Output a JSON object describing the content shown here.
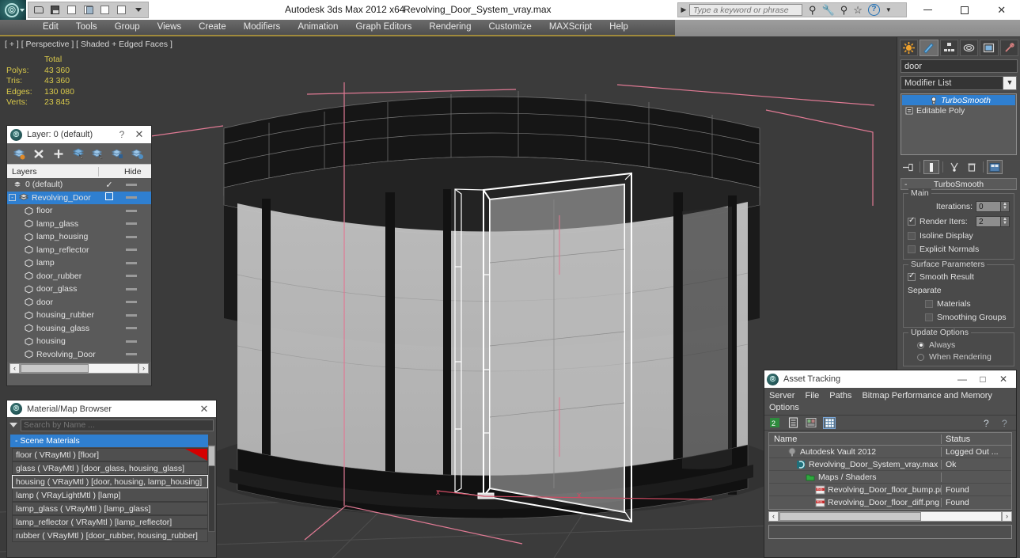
{
  "titlebar": {
    "app_title": "Autodesk 3ds Max  2012 x64",
    "file_name": "Revolving_Door_System_vray.max",
    "search_placeholder": "Type a keyword or phrase",
    "minimize": "—",
    "maximize": "□",
    "close": "✕",
    "help": "?",
    "quick_access": [
      "open-file-icon",
      "save-file-icon",
      "new-scene-icon",
      "set-xref-icon",
      "undo-icon",
      "redo-icon",
      "customize-qat-caret"
    ]
  },
  "menubar": {
    "items": [
      "Edit",
      "Tools",
      "Group",
      "Views",
      "Create",
      "Modifiers",
      "Animation",
      "Graph Editors",
      "Rendering",
      "Customize",
      "MAXScript",
      "Help"
    ]
  },
  "viewport": {
    "label": "[ + ] [ Perspective ] [ Shaded + Edged Faces ]",
    "stats": {
      "header": "Total",
      "rows": [
        {
          "label": "Polys:",
          "value": "43 360"
        },
        {
          "label": "Tris:",
          "value": "43 360"
        },
        {
          "label": "Edges:",
          "value": "130 080"
        },
        {
          "label": "Verts:",
          "value": "23 845"
        }
      ]
    },
    "gizmo_x_label": "x"
  },
  "layer_dialog": {
    "title": "Layer: 0 (default)",
    "help": "?",
    "close": "✕",
    "tools": [
      "create-new-layer-icon",
      "delete-highlighted-layers-icon",
      "add-selection-to-layer-icon",
      "select-objects-in-layer-icon",
      "select-highlighted-objects-icon",
      "highlight-selected-objects-layer-icon",
      "hide-unhide-layer-icon"
    ],
    "columns": {
      "layers": "Layers",
      "hide": "Hide"
    },
    "rows": [
      {
        "name": "0 (default)",
        "indent": 1,
        "selected": false,
        "check": "✓",
        "type": "layer"
      },
      {
        "name": "Revolving_Door",
        "indent": 1,
        "selected": true,
        "check": "box",
        "type": "layer",
        "expander": "-"
      },
      {
        "name": "floor",
        "indent": 2,
        "selected": false,
        "type": "object"
      },
      {
        "name": "lamp_glass",
        "indent": 2,
        "selected": false,
        "type": "object"
      },
      {
        "name": "lamp_housing",
        "indent": 2,
        "selected": false,
        "type": "object"
      },
      {
        "name": "lamp_reflector",
        "indent": 2,
        "selected": false,
        "type": "object"
      },
      {
        "name": "lamp",
        "indent": 2,
        "selected": false,
        "type": "object"
      },
      {
        "name": "door_rubber",
        "indent": 2,
        "selected": false,
        "type": "object"
      },
      {
        "name": "door_glass",
        "indent": 2,
        "selected": false,
        "type": "object"
      },
      {
        "name": "door",
        "indent": 2,
        "selected": false,
        "type": "object"
      },
      {
        "name": "housing_rubber",
        "indent": 2,
        "selected": false,
        "type": "object"
      },
      {
        "name": "housing_glass",
        "indent": 2,
        "selected": false,
        "type": "object"
      },
      {
        "name": "housing",
        "indent": 2,
        "selected": false,
        "type": "object"
      },
      {
        "name": "Revolving_Door",
        "indent": 2,
        "selected": false,
        "type": "object"
      }
    ],
    "scroll_left": "‹",
    "scroll_right": "›"
  },
  "material_browser": {
    "title": "Material/Map Browser",
    "close": "✕",
    "search_placeholder": "Search by Name ...",
    "group_label": "- Scene Materials",
    "items": [
      {
        "text": "floor  ( VRayMtl )  [floor]",
        "selected": false,
        "swatch": "#d40000"
      },
      {
        "text": "glass ( VRayMtl ) [door_glass, housing_glass]",
        "selected": false
      },
      {
        "text": "housing  ( VRayMtl )  [door, housing, lamp_housing]",
        "selected": true
      },
      {
        "text": "lamp  ( VRayLightMtl )  [lamp]",
        "selected": false
      },
      {
        "text": "lamp_glass ( VRayMtl ) [lamp_glass]",
        "selected": false
      },
      {
        "text": "lamp_reflector ( VRayMtl )  [lamp_reflector]",
        "selected": false
      },
      {
        "text": "rubber  ( VRayMtl ) [door_rubber, housing_rubber]",
        "selected": false
      }
    ]
  },
  "command_panel": {
    "tabs": [
      "create-tab-icon",
      "modify-tab-icon",
      "hierarchy-tab-icon",
      "motion-tab-icon",
      "display-tab-icon",
      "utilities-tab-icon"
    ],
    "active_tab_index": 1,
    "object_name": "door",
    "object_color": "#808080",
    "modifier_list_label": "Modifier List",
    "stack": [
      {
        "label": "TurboSmooth",
        "selected": true
      },
      {
        "label": "Editable Poly",
        "selected": false
      }
    ],
    "stack_buttons": [
      "pin-stack-icon",
      "show-end-result-icon",
      "make-unique-icon",
      "remove-modifier-icon",
      "configure-modifier-sets-icon"
    ],
    "rollout": {
      "title": "TurboSmooth",
      "collapse": "-",
      "main": {
        "group_label": "Main",
        "iterations_label": "Iterations:",
        "iterations_value": "0",
        "render_iters_label": "Render Iters:",
        "render_iters_value": "2",
        "render_iters_checked": true,
        "isoline_display_label": "Isoline Display",
        "isoline_display_checked": false,
        "explicit_normals_label": "Explicit Normals",
        "explicit_normals_checked": false
      },
      "surface": {
        "group_label": "Surface Parameters",
        "smooth_result_label": "Smooth Result",
        "smooth_result_checked": true,
        "separate_label": "Separate",
        "materials_label": "Materials",
        "materials_checked": false,
        "smoothing_groups_label": "Smoothing Groups",
        "smoothing_groups_checked": false
      },
      "update": {
        "group_label": "Update Options",
        "options": [
          {
            "label": "Always",
            "selected": true
          },
          {
            "label": "When Rendering",
            "selected": false
          }
        ]
      }
    }
  },
  "asset_tracking": {
    "title": "Asset Tracking",
    "minimize": "—",
    "maximize": "□",
    "close": "✕",
    "menus_line1": [
      "Server",
      "File",
      "Paths",
      "Bitmap Performance and Memory"
    ],
    "menus_line2": [
      "Options"
    ],
    "toolbar": [
      "vault-icon",
      "list-view-icon",
      "thumbnail-view-icon",
      "grid-view-icon",
      "help-icon",
      "context-help-icon"
    ],
    "columns": {
      "name": "Name",
      "status": "Status"
    },
    "rows": [
      {
        "name": "Autodesk Vault 2012",
        "status": "Logged Out ...",
        "indent": 1,
        "icon": "vault-node-icon"
      },
      {
        "name": "Revolving_Door_System_vray.max",
        "status": "Ok",
        "indent": 2,
        "icon": "max-file-icon"
      },
      {
        "name": "Maps / Shaders",
        "status": "",
        "indent": 3,
        "icon": "maps-folder-icon"
      },
      {
        "name": "Revolving_Door_floor_bump.png",
        "status": "Found",
        "indent": 4,
        "icon": "png-file-icon"
      },
      {
        "name": "Revolving_Door_floor_diff.png",
        "status": "Found",
        "indent": 4,
        "icon": "png-file-icon"
      }
    ],
    "scroll_left": "‹",
    "scroll_right": "›",
    "status_text": ""
  }
}
